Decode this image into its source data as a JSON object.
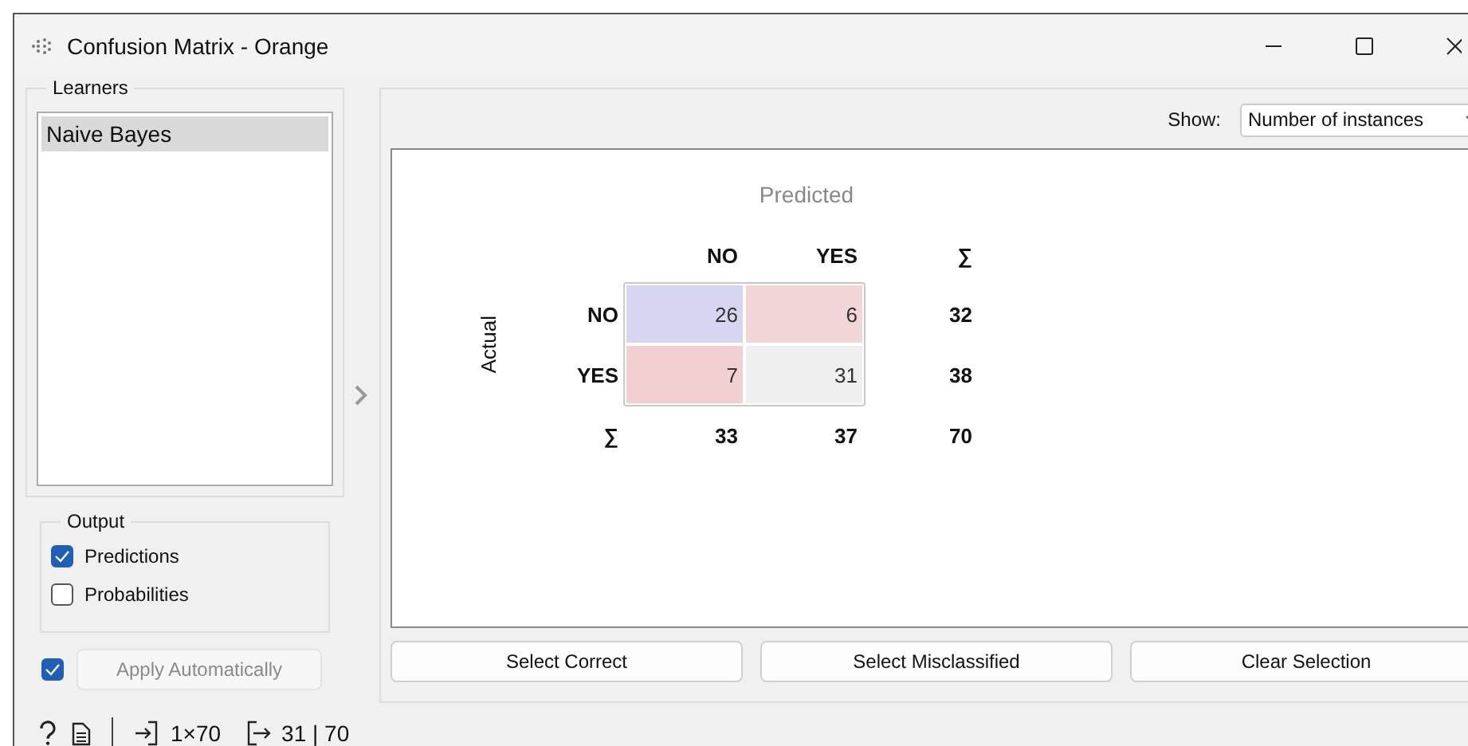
{
  "window": {
    "title": "Confusion Matrix - Orange"
  },
  "learners": {
    "title": "Learners",
    "items": [
      {
        "label": "Naive Bayes",
        "selected": true
      }
    ]
  },
  "output": {
    "title": "Output",
    "options": [
      {
        "label": "Predictions",
        "checked": true
      },
      {
        "label": "Probabilities",
        "checked": false
      }
    ]
  },
  "apply": {
    "checked": true,
    "label": "Apply Automatically",
    "disabled": true
  },
  "show": {
    "label": "Show:",
    "value": "Number of instances"
  },
  "matrix": {
    "predicted_label": "Predicted",
    "actual_label": "Actual",
    "columns": [
      "NO",
      "YES",
      "∑"
    ],
    "rows": [
      {
        "label": "NO",
        "cells": [
          {
            "value": "26",
            "color": "#d6d6f2"
          },
          {
            "value": "6",
            "color": "#f2d5d7"
          }
        ],
        "total": "32"
      },
      {
        "label": "YES",
        "cells": [
          {
            "value": "7",
            "color": "#f2cfd1"
          },
          {
            "value": "31",
            "color": "#efefef"
          }
        ],
        "total": "38"
      }
    ],
    "totals": {
      "label": "∑",
      "values": [
        "33",
        "37",
        "70"
      ]
    }
  },
  "buttons": [
    "Select Correct",
    "Select Misclassified",
    "Clear Selection"
  ],
  "status": {
    "input": "1×70",
    "output": "31 | 70"
  }
}
